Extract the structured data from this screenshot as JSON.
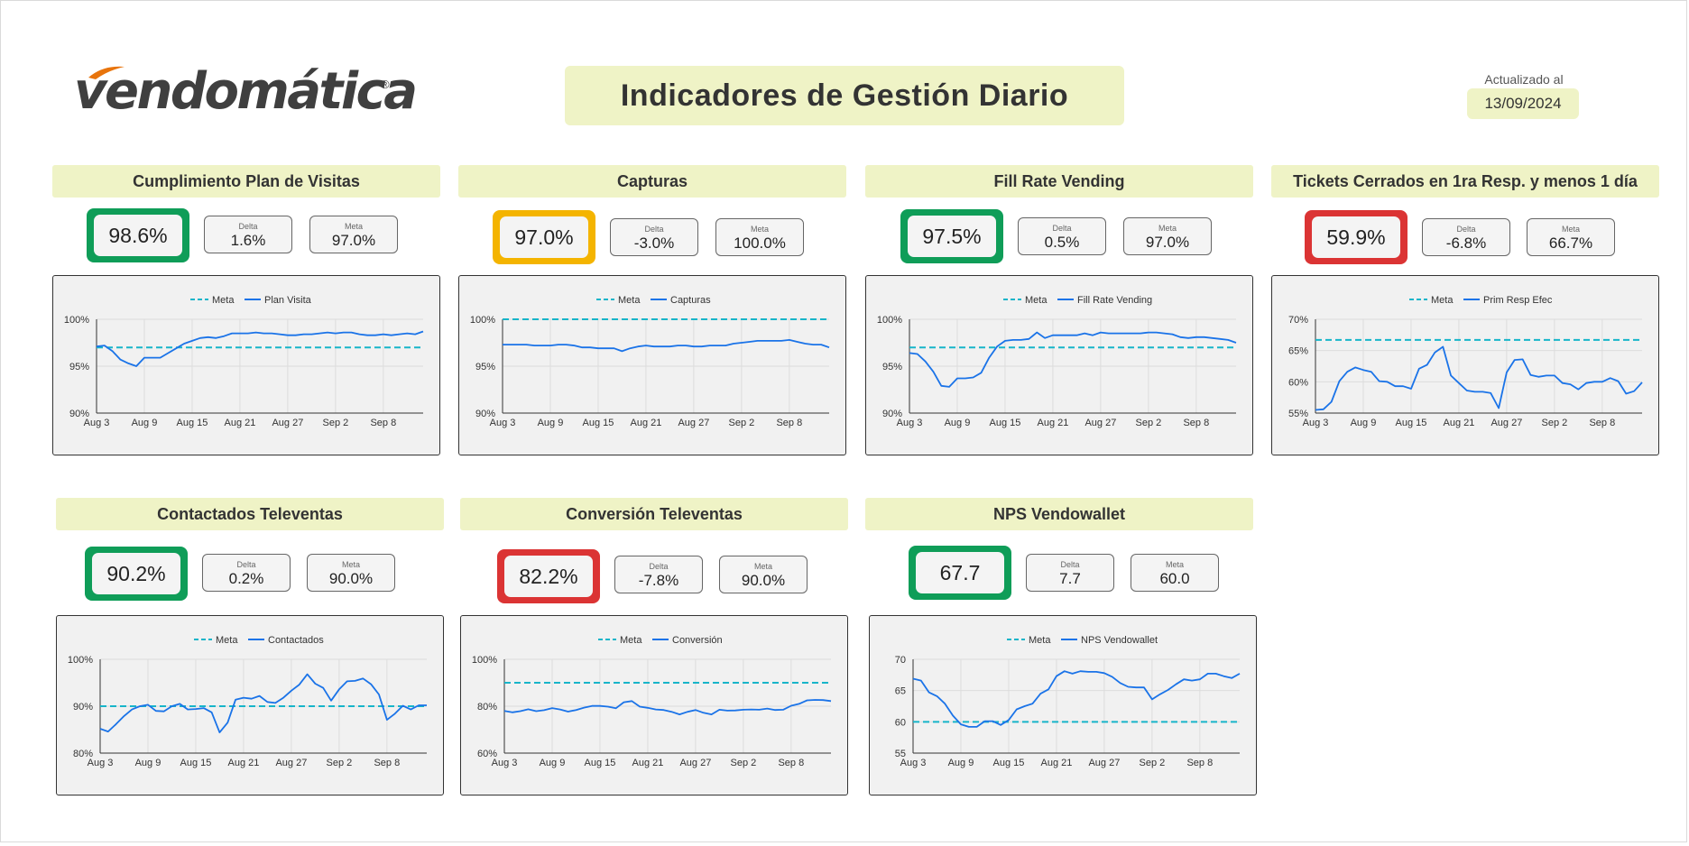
{
  "header": {
    "brand": "vendomática",
    "brand_mark": "®",
    "title": "Indicadores de Gestión Diario",
    "update_label": "Actualizado al",
    "update_date": "13/09/2024"
  },
  "colors": {
    "green": "#0f9d58",
    "orange": "#f4b400",
    "red": "#db3434",
    "title_bg": "#eff3c6",
    "meta_line": "#17b5c9",
    "series_line": "#1a73e8",
    "logo_accent": "#e8740c"
  },
  "panels": [
    {
      "title": "Cumplimiento Plan de Visitas",
      "value": "98.6%",
      "status": "green",
      "delta_label": "Delta",
      "delta": "1.6%",
      "meta_label": "Meta",
      "meta": "97.0%",
      "legend_meta": "Meta",
      "legend_series": "Plan Visita",
      "chart_data": {
        "type": "line",
        "x_ticks": [
          "Aug 3",
          "Aug 9",
          "Aug 15",
          "Aug 21",
          "Aug 27",
          "Sep 2",
          "Sep 8"
        ],
        "y_ticks": [
          "90%",
          "95%",
          "100%"
        ],
        "ylim": [
          90,
          100
        ],
        "meta_value": 97,
        "series": [
          {
            "name": "Plan Visita",
            "values": [
              97.1,
              97.2,
              96.6,
              95.7,
              95.3,
              95.0,
              95.9,
              95.9,
              95.9,
              96.4,
              96.9,
              97.4,
              97.7,
              98.0,
              98.1,
              98.0,
              98.2,
              98.5,
              98.5,
              98.5,
              98.6,
              98.5,
              98.5,
              98.4,
              98.3,
              98.3,
              98.4,
              98.4,
              98.5,
              98.6,
              98.5,
              98.6,
              98.6,
              98.4,
              98.3,
              98.3,
              98.4,
              98.3,
              98.4,
              98.5,
              98.4,
              98.7
            ]
          }
        ]
      }
    },
    {
      "title": "Capturas",
      "value": "97.0%",
      "status": "orange",
      "delta_label": "Delta",
      "delta": "-3.0%",
      "meta_label": "Meta",
      "meta": "100.0%",
      "legend_meta": "Meta",
      "legend_series": "Capturas",
      "chart_data": {
        "type": "line",
        "x_ticks": [
          "Aug 3",
          "Aug 9",
          "Aug 15",
          "Aug 21",
          "Aug 27",
          "Sep 2",
          "Sep 8"
        ],
        "y_ticks": [
          "90%",
          "95%",
          "100%"
        ],
        "ylim": [
          90,
          100
        ],
        "meta_value": 100,
        "series": [
          {
            "name": "Capturas",
            "values": [
              97.3,
              97.3,
              97.3,
              97.3,
              97.2,
              97.2,
              97.2,
              97.3,
              97.3,
              97.2,
              97.0,
              97.0,
              96.9,
              96.9,
              96.9,
              96.6,
              96.9,
              97.1,
              97.2,
              97.1,
              97.1,
              97.1,
              97.2,
              97.2,
              97.1,
              97.1,
              97.2,
              97.2,
              97.2,
              97.4,
              97.5,
              97.6,
              97.7,
              97.7,
              97.7,
              97.7,
              97.8,
              97.6,
              97.4,
              97.3,
              97.3,
              97.0
            ]
          }
        ]
      }
    },
    {
      "title": "Fill Rate Vending",
      "value": "97.5%",
      "status": "green",
      "delta_label": "Delta",
      "delta": "0.5%",
      "meta_label": "Meta",
      "meta": "97.0%",
      "legend_meta": "Meta",
      "legend_series": "Fill Rate Vending",
      "chart_data": {
        "type": "line",
        "x_ticks": [
          "Aug 3",
          "Aug 9",
          "Aug 15",
          "Aug 21",
          "Aug 27",
          "Sep 2",
          "Sep 8"
        ],
        "y_ticks": [
          "90%",
          "95%",
          "100%"
        ],
        "ylim": [
          90,
          100
        ],
        "meta_value": 97,
        "series": [
          {
            "name": "Fill Rate Vending",
            "values": [
              96.4,
              96.3,
              95.5,
              94.4,
              92.9,
              92.8,
              93.7,
              93.7,
              93.8,
              94.3,
              95.9,
              97.1,
              97.7,
              97.8,
              97.8,
              97.9,
              98.6,
              98.0,
              98.3,
              98.3,
              98.3,
              98.3,
              98.5,
              98.3,
              98.6,
              98.5,
              98.5,
              98.5,
              98.5,
              98.5,
              98.6,
              98.6,
              98.5,
              98.4,
              98.1,
              98.0,
              98.1,
              98.1,
              98.0,
              97.9,
              97.8,
              97.5
            ]
          }
        ]
      }
    },
    {
      "title": "Tickets Cerrados en 1ra Resp. y menos 1 día",
      "value": "59.9%",
      "status": "red",
      "delta_label": "Delta",
      "delta": "-6.8%",
      "meta_label": "Meta",
      "meta": "66.7%",
      "legend_meta": "Meta",
      "legend_series": "Prim Resp Efec",
      "chart_data": {
        "type": "line",
        "x_ticks": [
          "Aug 3",
          "Aug 9",
          "Aug 15",
          "Aug 21",
          "Aug 27",
          "Sep 2",
          "Sep 8"
        ],
        "y_ticks": [
          "55%",
          "60%",
          "65%",
          "70%"
        ],
        "ylim": [
          55,
          70
        ],
        "meta_value": 66.7,
        "series": [
          {
            "name": "Prim Resp Efec",
            "values": [
              55.5,
              55.6,
              56.8,
              60.1,
              61.6,
              62.3,
              61.9,
              61.6,
              60.1,
              60.0,
              59.3,
              59.3,
              58.9,
              62.1,
              62.7,
              64.7,
              65.6,
              61.0,
              59.8,
              58.6,
              58.4,
              58.4,
              58.2,
              55.8,
              61.5,
              63.5,
              63.6,
              61.1,
              60.8,
              61.0,
              61.0,
              59.8,
              59.6,
              58.8,
              59.8,
              60.0,
              60.0,
              60.6,
              60.1,
              58.1,
              58.5,
              59.9
            ]
          }
        ]
      }
    },
    {
      "title": "Contactados Televentas",
      "value": "90.2%",
      "status": "green",
      "delta_label": "Delta",
      "delta": "0.2%",
      "meta_label": "Meta",
      "meta": "90.0%",
      "legend_meta": "Meta",
      "legend_series": "Contactados",
      "chart_data": {
        "type": "line",
        "x_ticks": [
          "Aug 3",
          "Aug 9",
          "Aug 15",
          "Aug 21",
          "Aug 27",
          "Sep 2",
          "Sep 8"
        ],
        "y_ticks": [
          "80%",
          "90%",
          "100%"
        ],
        "ylim": [
          80,
          100
        ],
        "meta_value": 90,
        "series": [
          {
            "name": "Contactados",
            "values": [
              85.2,
              84.6,
              86.2,
              87.9,
              89.3,
              90.0,
              90.3,
              89.0,
              88.9,
              90.0,
              90.5,
              89.3,
              89.4,
              89.6,
              88.7,
              84.4,
              86.5,
              91.4,
              91.8,
              91.6,
              92.2,
              90.9,
              90.7,
              91.8,
              93.3,
              94.6,
              96.8,
              94.8,
              93.9,
              91.2,
              93.6,
              95.3,
              95.4,
              95.9,
              94.7,
              92.5,
              87.1,
              88.4,
              90.1,
              89.3,
              90.2,
              90.2
            ]
          }
        ]
      }
    },
    {
      "title": "Conversión Televentas",
      "value": "82.2%",
      "status": "red",
      "delta_label": "Delta",
      "delta": "-7.8%",
      "meta_label": "Meta",
      "meta": "90.0%",
      "legend_meta": "Meta",
      "legend_series": "Conversión",
      "chart_data": {
        "type": "line",
        "x_ticks": [
          "Aug 3",
          "Aug 9",
          "Aug 15",
          "Aug 21",
          "Aug 27",
          "Sep 2",
          "Sep 8"
        ],
        "y_ticks": [
          "60%",
          "80%",
          "100%"
        ],
        "ylim": [
          60,
          100
        ],
        "meta_value": 90,
        "series": [
          {
            "name": "Conversión",
            "values": [
              78.0,
              77.4,
              77.9,
              78.7,
              77.9,
              78.3,
              79.2,
              78.6,
              77.7,
              78.4,
              79.4,
              80.1,
              80.1,
              79.8,
              79.1,
              81.7,
              82.2,
              79.8,
              79.3,
              78.6,
              78.4,
              77.6,
              76.5,
              77.6,
              78.4,
              77.2,
              76.5,
              78.5,
              78.1,
              78.2,
              78.5,
              78.6,
              78.5,
              79.0,
              78.4,
              78.5,
              80.2,
              81.0,
              82.5,
              82.7,
              82.6,
              82.2
            ]
          }
        ]
      }
    },
    {
      "title": "NPS Vendowallet",
      "value": "67.7",
      "status": "green",
      "delta_label": "Delta",
      "delta": "7.7",
      "meta_label": "Meta",
      "meta": "60.0",
      "legend_meta": "Meta",
      "legend_series": "NPS Vendowallet",
      "chart_data": {
        "type": "line",
        "x_ticks": [
          "Aug 3",
          "Aug 9",
          "Aug 15",
          "Aug 21",
          "Aug 27",
          "Sep 2",
          "Sep 8"
        ],
        "y_ticks": [
          "55",
          "60",
          "65",
          "70"
        ],
        "ylim": [
          55,
          70
        ],
        "meta_value": 60,
        "series": [
          {
            "name": "NPS Vendowallet",
            "values": [
              66.9,
              66.6,
              64.7,
              64.1,
              62.9,
              61.0,
              59.6,
              59.2,
              59.2,
              60.1,
              60.1,
              59.5,
              60.3,
              62.0,
              62.5,
              62.9,
              64.5,
              65.2,
              67.3,
              68.1,
              67.7,
              68.1,
              68.0,
              68.0,
              67.8,
              67.2,
              66.2,
              65.6,
              65.5,
              65.5,
              63.6,
              64.4,
              65.1,
              66.0,
              66.8,
              66.6,
              66.8,
              67.7,
              67.7,
              67.3,
              67.0,
              67.7
            ]
          }
        ]
      }
    }
  ]
}
